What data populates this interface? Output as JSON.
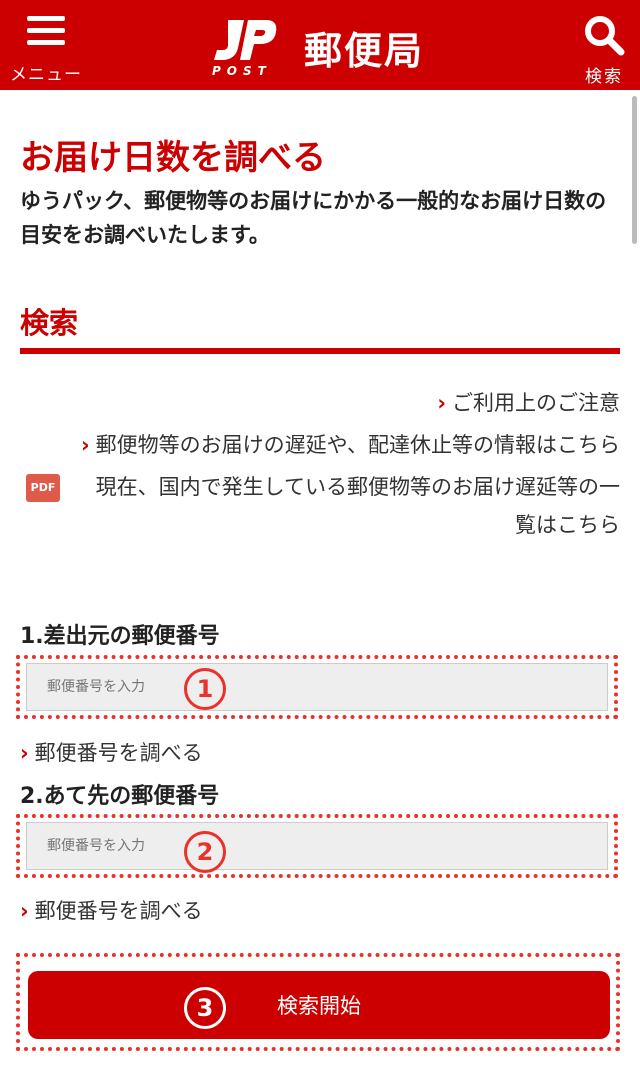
{
  "header": {
    "menu_label": "メニュー",
    "logo_post": "POST",
    "logo_name": "郵便局",
    "search_label": "検索"
  },
  "page": {
    "title": "お届け日数を調べる",
    "description": "ゆうパック、郵便物等のお届けにかかる一般的なお届け日数の目安をお調べいたします。"
  },
  "search_section": {
    "title": "検索",
    "links": {
      "notice": "ご利用上のご注意",
      "delay_info": "郵便物等のお届けの遅延や、配達休止等の情報はこちら",
      "pdf_label": "PDF",
      "domestic_delay": "現在、国内で発生している郵便物等のお届け遅延等の一覧はこちら"
    }
  },
  "form": {
    "origin_label": "1.差出元の郵便番号",
    "origin_placeholder": "郵便番号を入力",
    "origin_lookup": "郵便番号を調べる",
    "dest_label": "2.あて先の郵便番号",
    "dest_placeholder": "郵便番号を入力",
    "dest_lookup": "郵便番号を調べる",
    "submit_label": "検索開始"
  },
  "annotations": {
    "step1": "1",
    "step2": "2",
    "step3": "3"
  },
  "colors": {
    "brand_red": "#cc0000",
    "annotation_red": "#e8322a"
  }
}
